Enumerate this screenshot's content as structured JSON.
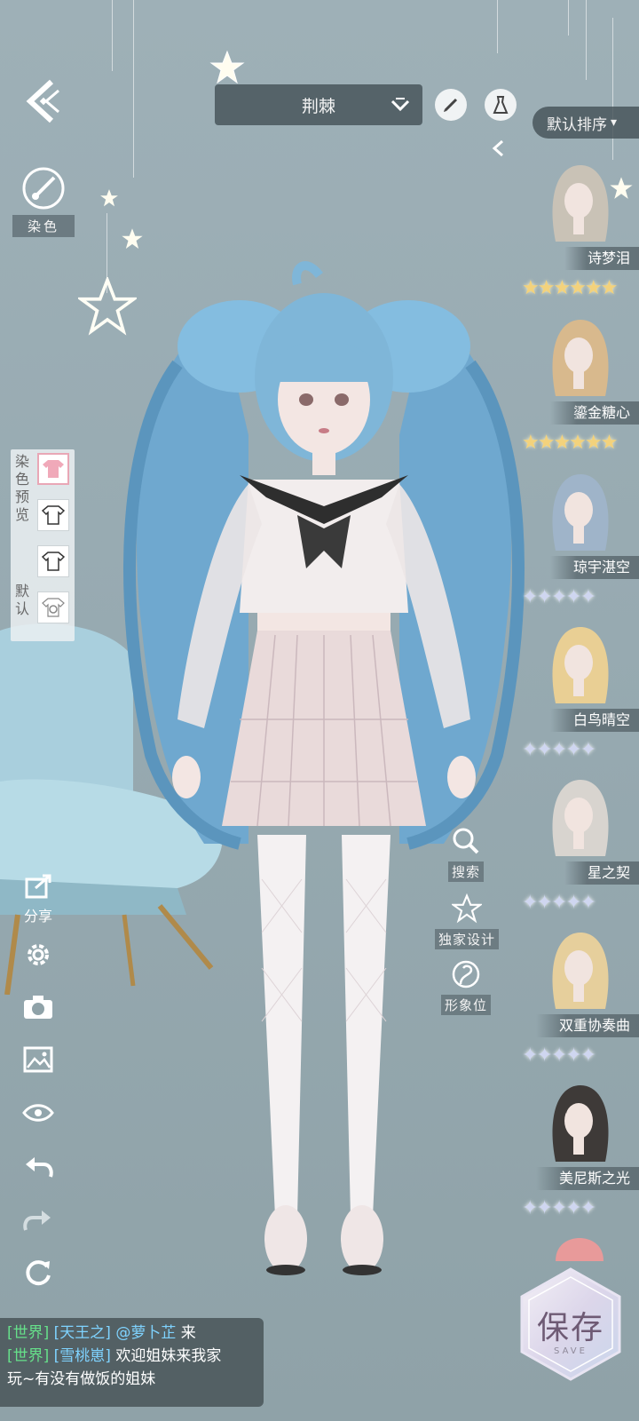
{
  "header": {
    "outfit_name": "荆棘",
    "sort_label": "默认排序",
    "sort_arrow": "▾"
  },
  "left_panel": {
    "dye_label": "染色",
    "dye_preview_label_chars": [
      "染",
      "色",
      "预",
      "览"
    ],
    "default_label_chars": [
      "默",
      "认"
    ],
    "share_label": "分享"
  },
  "mid_actions": {
    "search_label": "搜索",
    "exclusive_label": "独家设计",
    "image_slot_label": "形象位"
  },
  "hair_list": [
    {
      "name": "诗梦泪",
      "stars": "★★★★★★",
      "tier": "gold",
      "hair_color": "#c9c2b6"
    },
    {
      "name": "鎏金糖心",
      "stars": "★★★★★★",
      "tier": "gold",
      "hair_color": "#d8b98d"
    },
    {
      "name": "琼宇湛空",
      "stars": "✦✦✦✦✦",
      "tier": "silver",
      "hair_color": "#9fb4c9"
    },
    {
      "name": "白鸟晴空",
      "stars": "✦✦✦✦✦",
      "tier": "silver",
      "hair_color": "#e9cf94"
    },
    {
      "name": "星之契",
      "stars": "✦✦✦✦✦",
      "tier": "silver",
      "hair_color": "#d8d4cf"
    },
    {
      "name": "双重协奏曲",
      "stars": "✦✦✦✦✦",
      "tier": "silver",
      "hair_color": "#e6cf9c"
    },
    {
      "name": "美尼斯之光",
      "stars": "✦✦✦✦✦",
      "tier": "silver",
      "hair_color": "#3e3a38"
    }
  ],
  "chat": {
    "line1": {
      "channel": "[世界]",
      "user": "[天王之]",
      "text_user": "@萝卜芷",
      "text": "来"
    },
    "line2": {
      "channel": "[世界]",
      "user": "[雪桃崽]",
      "text": "欢迎姐妹来我家"
    },
    "line3": {
      "text": "玩~有没有做饭的姐妹"
    }
  },
  "save": {
    "label": "保存",
    "sub": "SAVE"
  },
  "colors": {
    "background": "#9aaeb5",
    "hair_main": "#7fb6d8",
    "chat_channel": "#66e08a",
    "chat_user": "#7fd3ff"
  }
}
